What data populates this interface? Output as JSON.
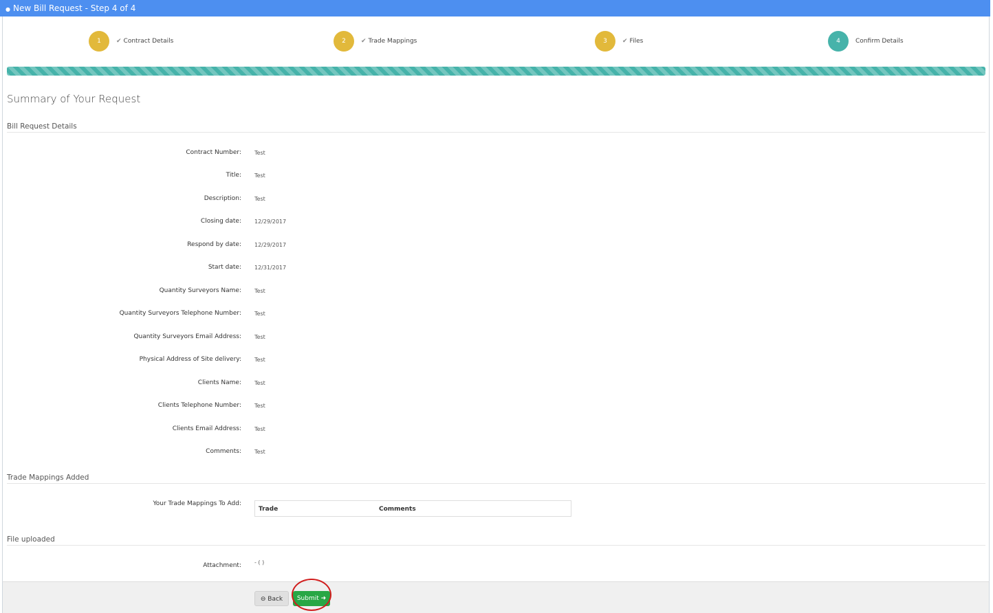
{
  "window": {
    "title": "New Bill Request - Step 4 of 4",
    "title_icon": "lock-icon"
  },
  "steps": [
    {
      "number": "1",
      "label": "Contract Details",
      "done": true
    },
    {
      "number": "2",
      "label": "Trade Mappings",
      "done": true
    },
    {
      "number": "3",
      "label": "Files",
      "done": true
    },
    {
      "number": "4",
      "label": "Confirm Details",
      "done": false
    }
  ],
  "progress": {
    "percent": 100,
    "color": "#46b3aa"
  },
  "summary": {
    "title": "Summary of Your Request",
    "details_heading": "Bill Request Details",
    "fields": [
      {
        "label": "Contract Number:",
        "value": "Test"
      },
      {
        "label": "Title:",
        "value": "Test"
      },
      {
        "label": "Description:",
        "value": "Test"
      },
      {
        "label": "Closing date:",
        "value": "12/29/2017"
      },
      {
        "label": "Respond by date:",
        "value": "12/29/2017"
      },
      {
        "label": "Start date:",
        "value": "12/31/2017"
      },
      {
        "label": "Quantity Surveyors Name:",
        "value": "Test"
      },
      {
        "label": "Quantity Surveyors Telephone Number:",
        "value": "Test"
      },
      {
        "label": "Quantity Surveyors Email Address:",
        "value": "Test"
      },
      {
        "label": "Physical Address of Site delivery:",
        "value": "Test"
      },
      {
        "label": "Clients Name:",
        "value": "Test"
      },
      {
        "label": "Clients Telephone Number:",
        "value": "Test"
      },
      {
        "label": "Clients Email Address:",
        "value": "Test"
      },
      {
        "label": "Comments:",
        "value": "Test"
      }
    ],
    "trade_heading": "Trade Mappings Added",
    "trade_label": "Your Trade Mappings To Add:",
    "trade_columns": [
      "Trade",
      "Comments"
    ],
    "file_heading": "File uploaded",
    "attachment_label": "Attachment:",
    "attachment_value": "- ( )"
  },
  "footer": {
    "back_label": "Back",
    "submit_label": "Submit"
  },
  "colors": {
    "titlebar": "#4d8ff0",
    "step_done": "#e2b93b",
    "step_active": "#46b3aa",
    "submit": "#28a745",
    "highlight": "#d01c1c"
  }
}
